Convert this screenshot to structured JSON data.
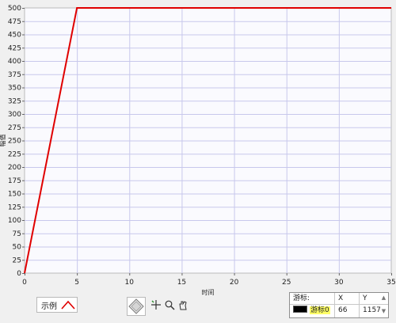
{
  "window": {
    "title_fragment": ""
  },
  "chart_data": {
    "type": "line",
    "title": "",
    "xlabel": "时间",
    "ylabel": "幅值",
    "xlim": [
      0,
      35
    ],
    "ylim": [
      0,
      500
    ],
    "x_ticks": [
      0,
      5,
      10,
      15,
      20,
      25,
      30,
      35
    ],
    "y_ticks": [
      0,
      25,
      50,
      75,
      100,
      125,
      150,
      175,
      200,
      225,
      250,
      275,
      300,
      325,
      350,
      375,
      400,
      425,
      450,
      475,
      500
    ],
    "grid": true,
    "series": [
      {
        "color": "#e00000",
        "x": [
          0,
          5,
          35
        ],
        "y": [
          0,
          500,
          500
        ]
      }
    ]
  },
  "legend": {
    "label": "示例",
    "icon": "red-line-swatch-icon"
  },
  "graph_tools": {
    "pan_zoom_icon": "diamond-zoom-icon",
    "cursor_tool_icon": "crosshair-icon",
    "zoom_tool_icon": "magnifier-zoom-icon",
    "pan_tool_icon": "hand-pan-icon"
  },
  "cursor_legend": {
    "header_name": "游标:",
    "header_x": "X",
    "header_y": "Y",
    "rows": [
      {
        "name": "游标0",
        "x": "66",
        "y": "1157",
        "swatch_color": "#000000"
      }
    ]
  }
}
